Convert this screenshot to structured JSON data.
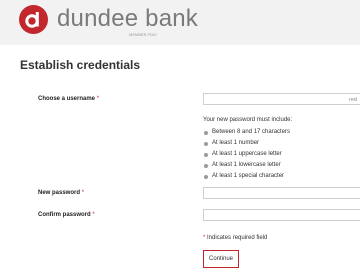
{
  "header": {
    "brand_name": "dundee bank",
    "member_text": "MEMBER FDIC",
    "brand_color": "#c1272d",
    "logo_icon": "dundee-d-logo-icon"
  },
  "page": {
    "title": "Establish credentials"
  },
  "form": {
    "username_label": "Choose a username",
    "username_value": "",
    "username_hint": "red",
    "password_intro": "Your new password must include:",
    "password_requirements": [
      "Between 8 and 17 characters",
      "At least 1 number",
      "At least 1 uppercase letter",
      "At least 1 lowercase letter",
      "At least 1 special character"
    ],
    "new_password_label": "New password",
    "new_password_value": "",
    "confirm_password_label": "Confirm password",
    "confirm_password_value": "",
    "required_marker": "*",
    "required_note": "* Indicates required field",
    "continue_label": "Continue"
  }
}
